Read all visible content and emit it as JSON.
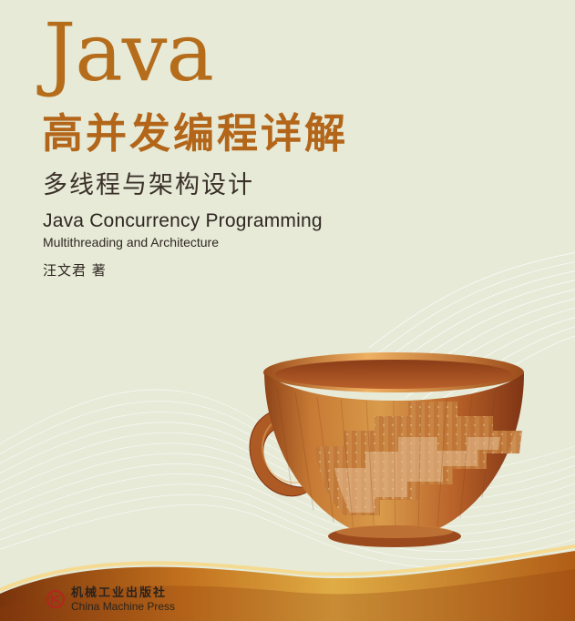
{
  "cover": {
    "title_java": "Java",
    "title_cn": "高并发编程详解",
    "subtitle_cn": "多线程与架构设计",
    "title_en": "Java Concurrency Programming",
    "subtitle_en": "Multithreading and Architecture",
    "author": "汪文君 著",
    "publisher_cn": "机械工业出版社",
    "publisher_en": "China Machine Press"
  },
  "icons": {
    "publisher_logo": "publisher-logo-icon",
    "cup": "coffee-cup-illustration"
  },
  "colors": {
    "background": "#e6ead7",
    "title_orange": "#b56d1c",
    "dark_text": "#2f2720",
    "wave_lines": "#ffffff",
    "cup_wood_light": "#d79b48",
    "cup_wood_dark": "#9f4d1f",
    "bottom_band": "#b86817"
  }
}
